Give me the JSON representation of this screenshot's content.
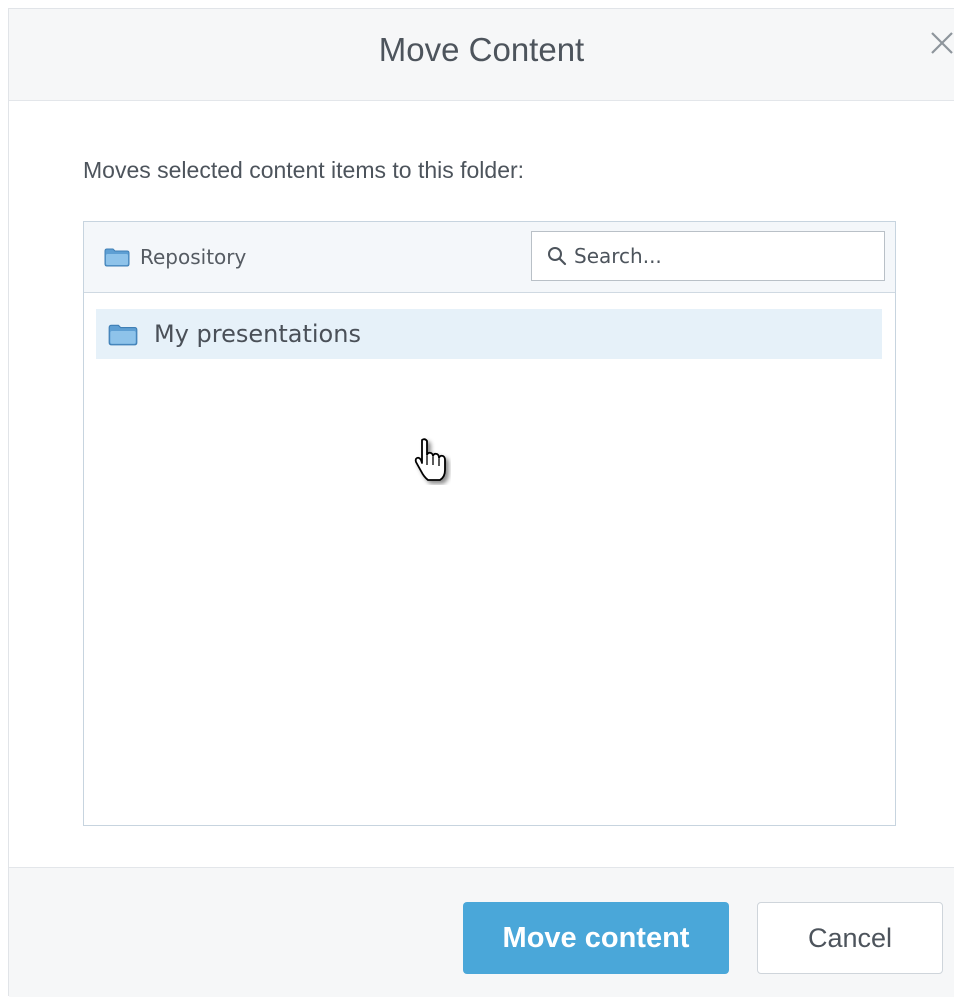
{
  "dialog": {
    "title": "Move Content",
    "close_icon": "close-icon"
  },
  "body": {
    "instruction": "Moves selected content items to this folder:"
  },
  "browser": {
    "root_label": "Repository",
    "root_icon": "folder-icon",
    "search": {
      "placeholder": "Search...",
      "value": "",
      "icon": "search-icon"
    },
    "folders": [
      {
        "label": "My presentations",
        "icon": "folder-icon",
        "state": "hovered"
      }
    ]
  },
  "footer": {
    "primary_label": "Move content",
    "secondary_label": "Cancel"
  },
  "colors": {
    "accent": "#4aa7d9",
    "header_bg": "#f6f7f8",
    "row_hover": "#e6f1f9",
    "text": "#4d545c"
  },
  "cursor": "hand-pointer-icon"
}
